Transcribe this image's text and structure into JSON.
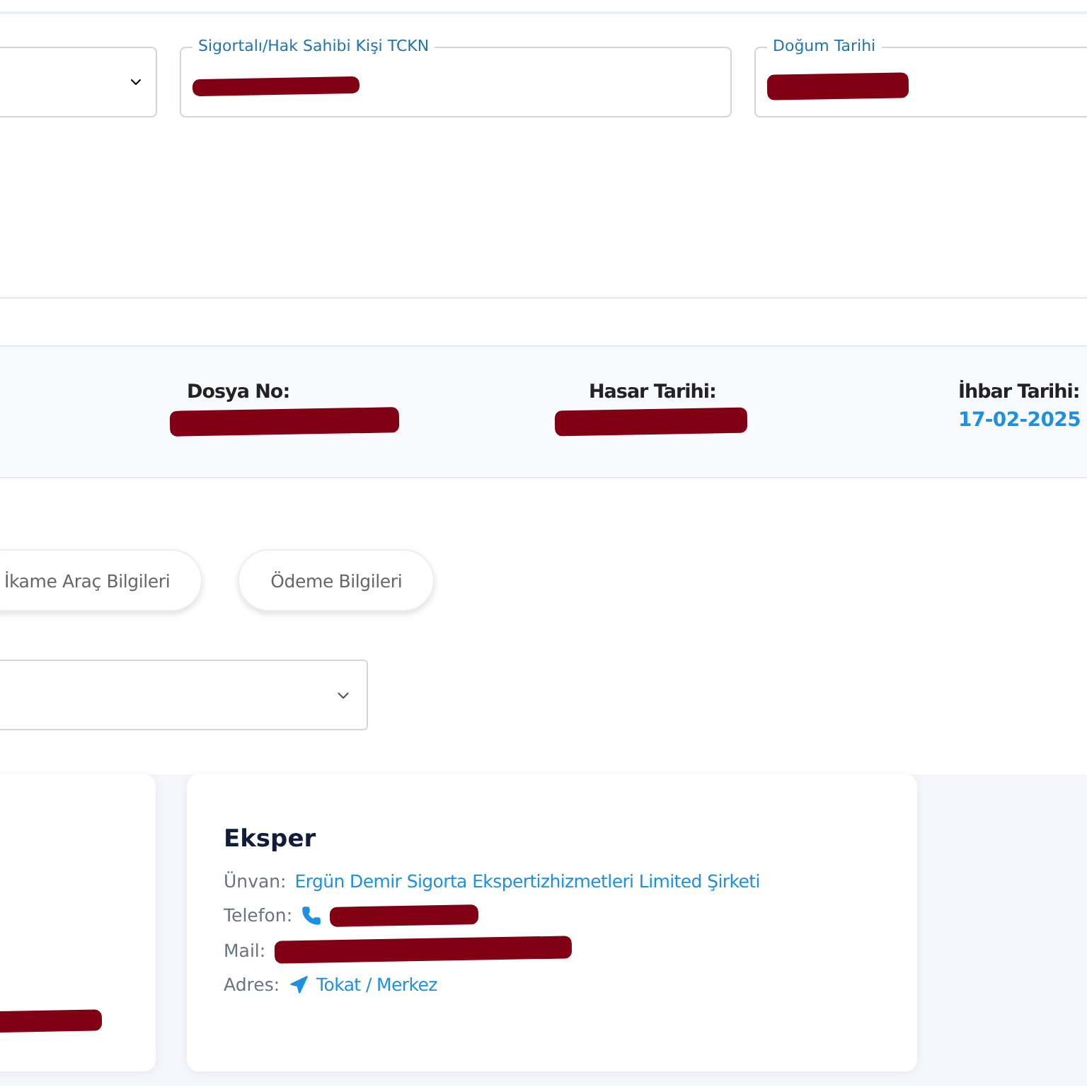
{
  "search_form": {
    "fields": [
      {
        "kind": "select"
      },
      {
        "kind": "text",
        "label": "Sigortalı/Hak Sahibi Kişi TCKN",
        "redacted": true
      },
      {
        "kind": "date",
        "label": "Doğum Tarihi",
        "redacted": true
      }
    ]
  },
  "file_summary": [
    {
      "label": "Dosya No:",
      "redacted": true
    },
    {
      "label": "Hasar Tarihi:",
      "redacted": true
    },
    {
      "label": "İhbar Tarihi:",
      "value": "17-02-2025"
    }
  ],
  "tabs": [
    {
      "label": "İkame Araç Bilgileri",
      "selected": false
    },
    {
      "label": "Ödeme Bilgileri",
      "selected": false
    }
  ],
  "cards": [
    {
      "kind": "partial",
      "redacted": true
    },
    {
      "kind": "contact",
      "title": "Eksper",
      "rows": [
        {
          "kind": "text",
          "label": "Ünvan:",
          "value": "Ergün Demir Sigorta Ekspertizhizmetleri Limited Şirketi"
        },
        {
          "kind": "phone",
          "label": "Telefon:",
          "redacted": true
        },
        {
          "kind": "mail",
          "label": "Mail:",
          "redacted": true
        },
        {
          "kind": "address",
          "label": "Adres:",
          "value": "Tokat / Merkez"
        }
      ]
    }
  ]
}
